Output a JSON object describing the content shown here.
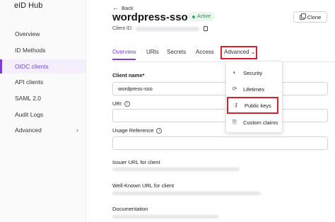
{
  "sidebar": {
    "brand": "eID Hub",
    "items": [
      {
        "label": "Overview"
      },
      {
        "label": "ID Methods"
      },
      {
        "label": "OIDC clients"
      },
      {
        "label": "API clients"
      },
      {
        "label": "SAML 2.0"
      },
      {
        "label": "Audit Logs"
      },
      {
        "label": "Advanced",
        "chevron": "›"
      }
    ]
  },
  "header": {
    "back_label": "Back",
    "back_icon": "←",
    "title": "wordpress-sso",
    "status": "Active",
    "clone_label": "Clone",
    "client_id_label": "Client ID:"
  },
  "tabs": [
    {
      "label": "Overview"
    },
    {
      "label": "URIs"
    },
    {
      "label": "Secrets"
    },
    {
      "label": "Access"
    },
    {
      "label": "Advanced ⌄"
    }
  ],
  "form": {
    "client_name_label": "Client name",
    "client_name_required": "*",
    "client_name_value": "wordpress-sso",
    "uri_label": "URI",
    "usage_label": "Usage Reference",
    "issuer_label": "Issuer URL for client",
    "wellknown_label": "Well-Known URL for client",
    "documentation_label": "Documentation"
  },
  "dropdown": {
    "items": [
      {
        "label": "Security",
        "icon": "◐"
      },
      {
        "label": "Lifetimes",
        "icon": "⟳"
      },
      {
        "label": "Public keys",
        "icon": "⚷"
      },
      {
        "label": "Custom claims",
        "icon": "⎘"
      }
    ]
  },
  "colors": {
    "accent": "#7a3fd6",
    "highlight_border": "#d6202a",
    "status_green": "#2d8a4f"
  }
}
